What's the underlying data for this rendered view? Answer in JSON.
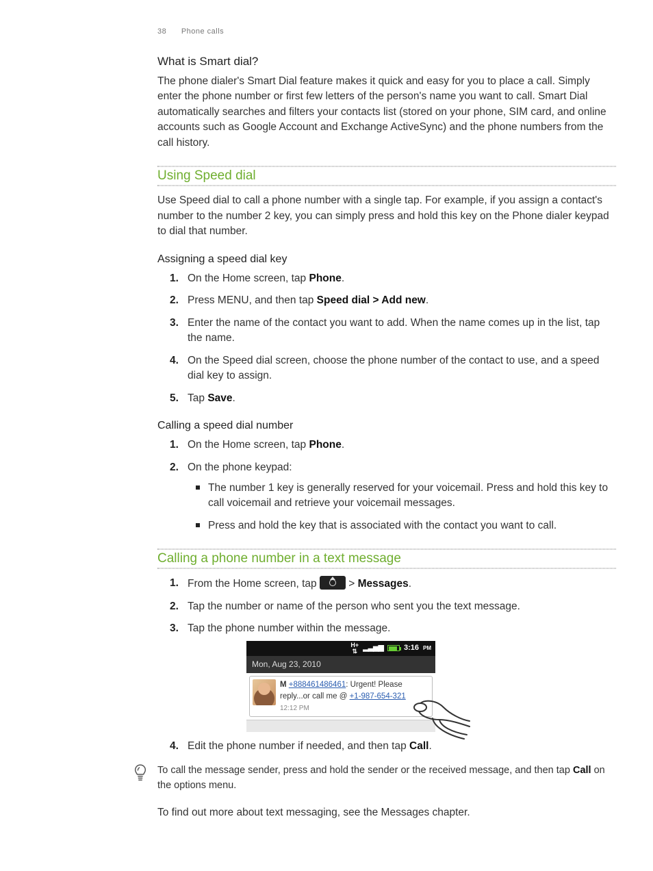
{
  "header": {
    "page_number": "38",
    "chapter": "Phone calls"
  },
  "section_smart": {
    "title": "What is Smart dial?",
    "body": "The phone dialer's Smart Dial feature makes it quick and easy for you to place a call. Simply enter the phone number or first few letters of the person's name you want to call. Smart Dial automatically searches and filters your contacts list (stored on your phone, SIM card, and online accounts such as Google Account and Exchange ActiveSync) and the phone numbers from the call history."
  },
  "section_speed": {
    "title": "Using Speed dial",
    "intro": "Use Speed dial to call a phone number with a single tap. For example, if you assign a contact's number to the number 2 key, you can simply press and hold this key on the Phone dialer keypad to dial that number.",
    "assign_title": "Assigning a speed dial key",
    "assign_steps": {
      "s1a": "On the Home screen, tap ",
      "s1b": "Phone",
      "s1c": ".",
      "s2a": "Press MENU, and then tap ",
      "s2b": "Speed dial > Add new",
      "s2c": ".",
      "s3": "Enter the name of the contact you want to add. When the name comes up in the list, tap the name.",
      "s4": "On the Speed dial screen, choose the phone number of the contact to use, and a speed dial key to assign.",
      "s5a": "Tap ",
      "s5b": "Save",
      "s5c": "."
    },
    "call_title": "Calling a speed dial number",
    "call_steps": {
      "s1a": "On the Home screen, tap ",
      "s1b": "Phone",
      "s1c": ".",
      "s2": "On the phone keypad:",
      "b1": "The number 1 key is generally reserved for your voicemail. Press and hold this key to call voicemail and retrieve your voicemail messages.",
      "b2": "Press and hold the key that is associated with the contact you want to call."
    }
  },
  "section_text": {
    "title": "Calling a phone number in a text message",
    "steps": {
      "s1a": "From the Home screen, tap ",
      "s1b": " > ",
      "s1c": "Messages",
      "s1d": ".",
      "s2": "Tap the number or name of the person who sent you the text message.",
      "s3": "Tap the phone number within the message.",
      "s4a": "Edit the phone number if needed, and then tap ",
      "s4b": "Call",
      "s4c": "."
    },
    "tip_a": "To call the message sender, press and hold the sender or the received message, and then tap ",
    "tip_b": "Call",
    "tip_c": " on the options menu.",
    "outro": "To find out more about text messaging, see the Messages chapter."
  },
  "mock": {
    "status_time": "3:16",
    "status_ampm": "PM",
    "date": "Mon, Aug 23, 2010",
    "sender_prefix": "M ",
    "sender_num": "+888461486461",
    "msg_a": ": Urgent! Please reply...or call me @ ",
    "msg_link": "+1-987-654-321",
    "msg_time": "12:12 PM"
  }
}
